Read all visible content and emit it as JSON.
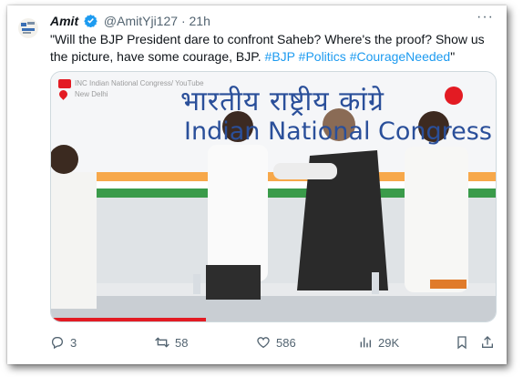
{
  "tweet": {
    "author_name": "Amit",
    "handle": "@AmitYji127",
    "separator": "·",
    "time": "21h",
    "more_label": "···",
    "text": "\"Will the BJP President dare to confront Saheb? Where's the proof? Show us the picture, have some courage, BJP. ",
    "hashtags": [
      "#BJP",
      "#Politics",
      "#CourageNeeded"
    ],
    "text_end": "\""
  },
  "media": {
    "watermark_channel": "INC Indian National Congress/ YouTube",
    "watermark_location": "New Delhi",
    "sign_hindi": "भारतीय राष्ट्रीय कांग्रे",
    "sign_english": "Indian National Congress"
  },
  "actions": {
    "reply_count": "3",
    "retweet_count": "58",
    "like_count": "586",
    "views_count": "29K"
  },
  "colors": {
    "accent": "#1d9bf0",
    "verified": "#1d9bf0",
    "text": "#0f1419",
    "muted": "#536471"
  }
}
